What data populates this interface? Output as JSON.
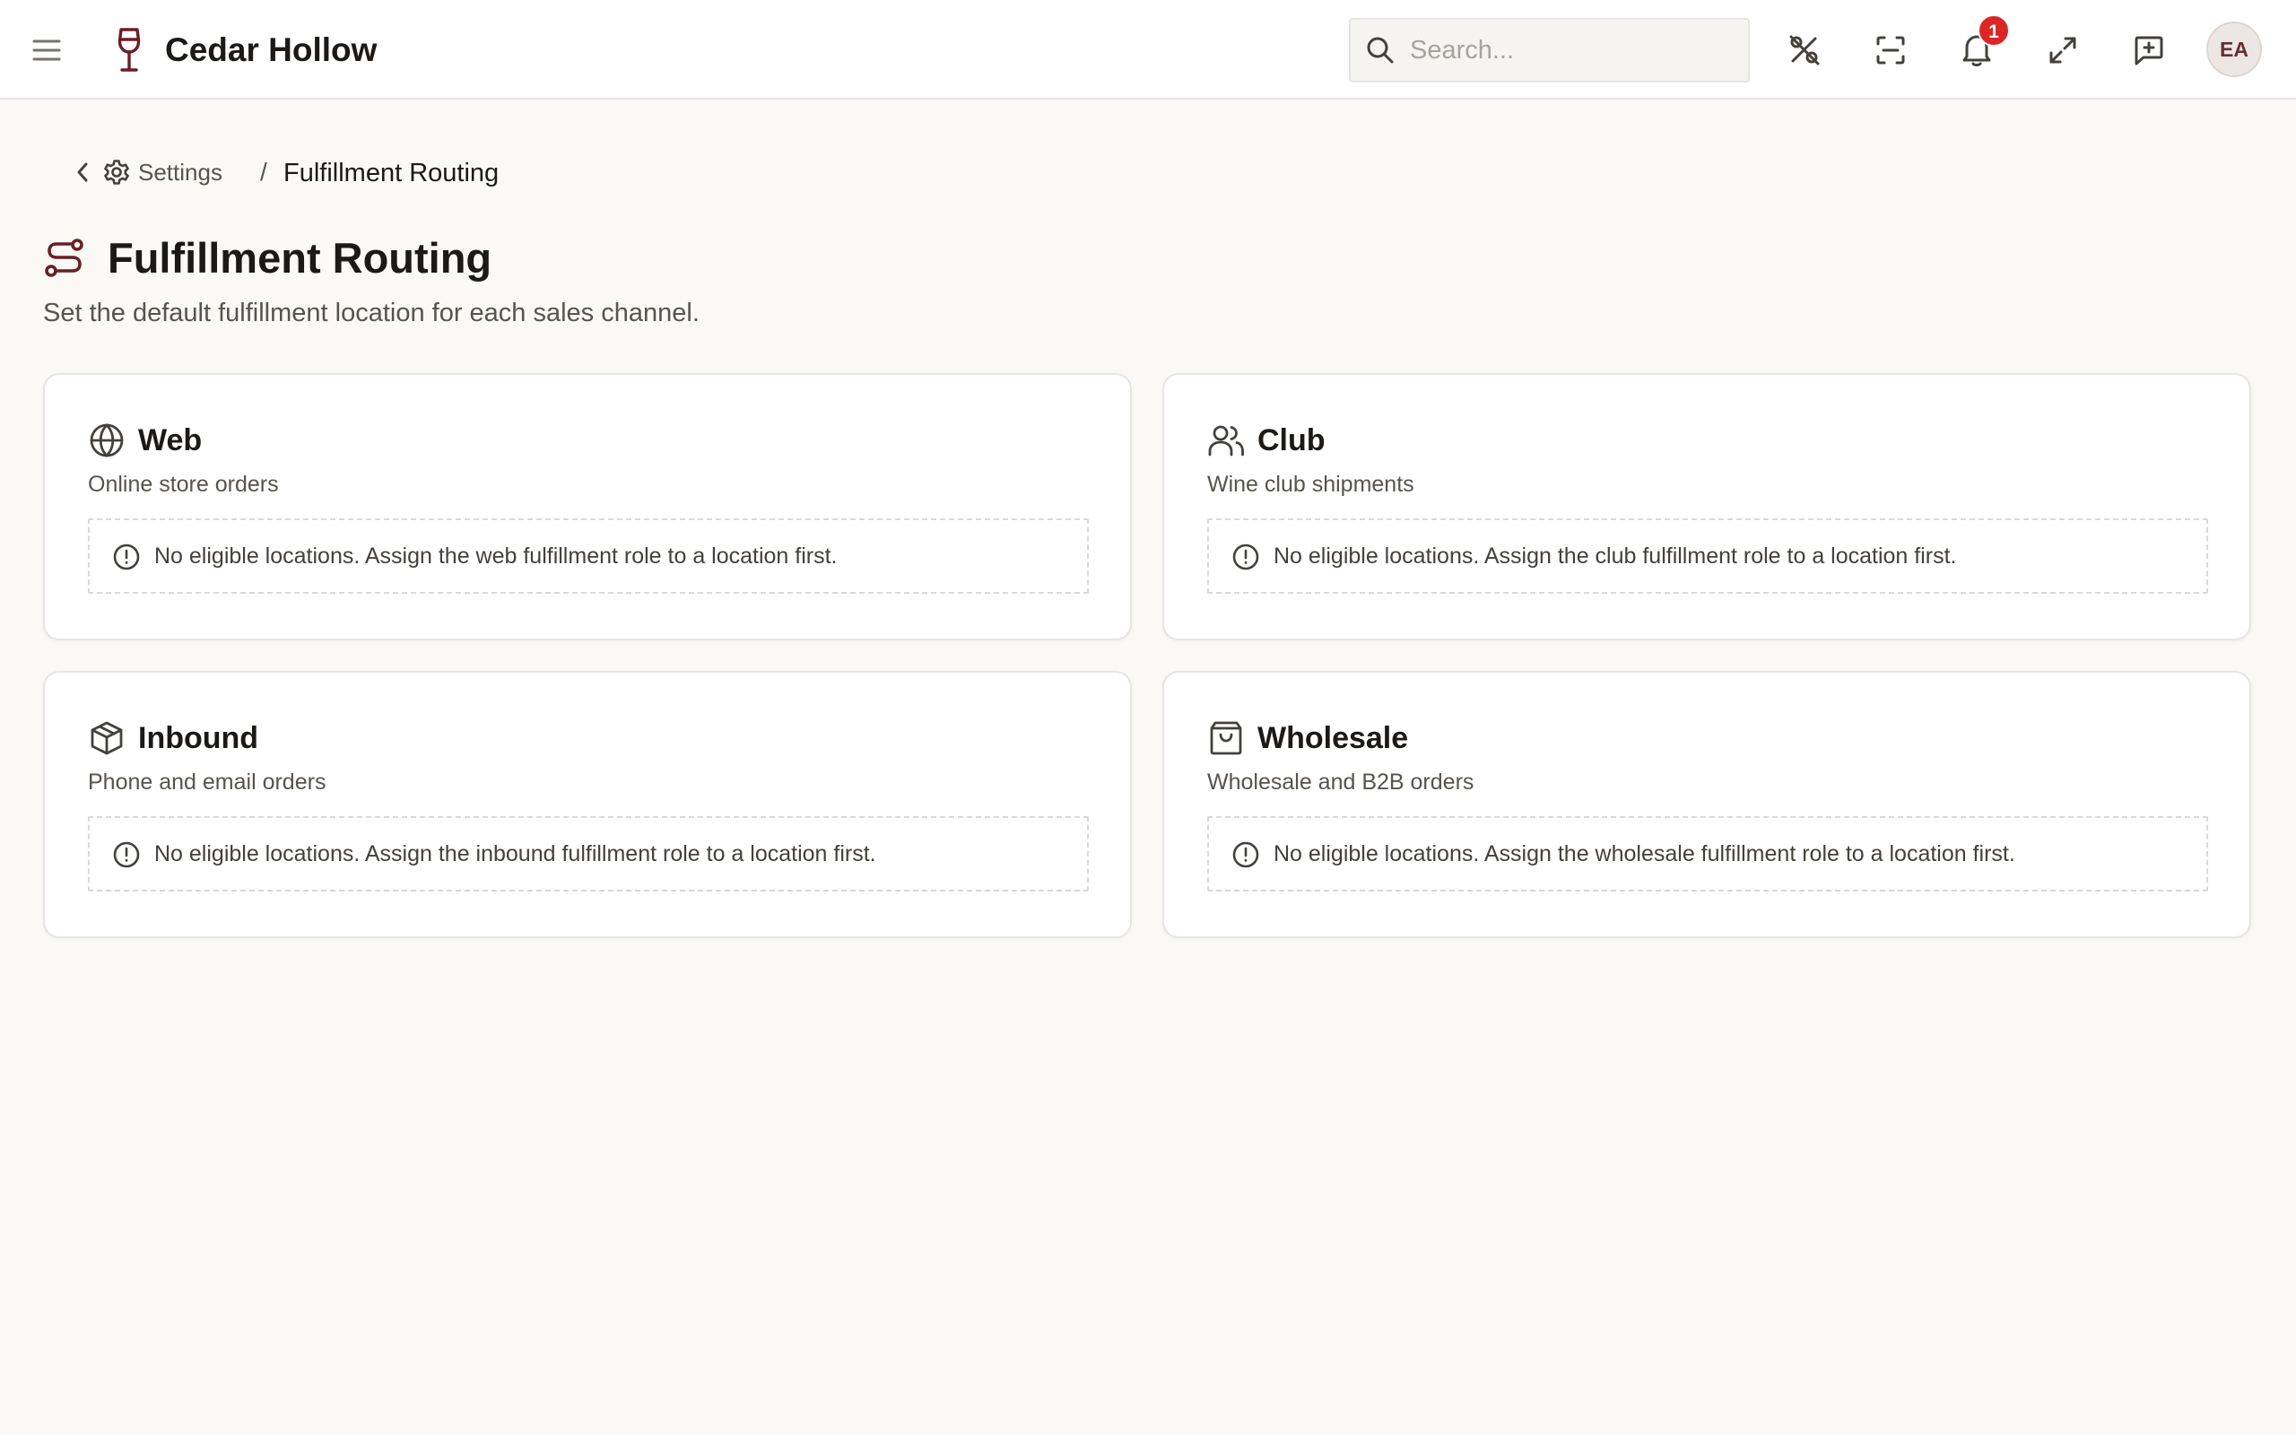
{
  "app": {
    "name": "Cedar Hollow",
    "brand_color": "#6b1e24"
  },
  "header": {
    "search_placeholder": "Search...",
    "notification_count": "1",
    "avatar_initials": "EA",
    "icons": [
      "menu-icon",
      "wine-glass-icon",
      "search-icon",
      "percent-slash-icon",
      "scan-icon",
      "bell-icon",
      "expand-icon",
      "message-plus-icon"
    ]
  },
  "breadcrumb": {
    "parent": "Settings",
    "separator": "/",
    "current": "Fulfillment Routing"
  },
  "page": {
    "title": "Fulfillment Routing",
    "subtitle": "Set the default fulfillment location for each sales channel."
  },
  "channels": [
    {
      "icon": "globe-icon",
      "title": "Web",
      "description": "Online store orders",
      "notice": "No eligible locations. Assign the web fulfillment role to a location first."
    },
    {
      "icon": "users-icon",
      "title": "Club",
      "description": "Wine club shipments",
      "notice": "No eligible locations. Assign the club fulfillment role to a location first."
    },
    {
      "icon": "package-icon",
      "title": "Inbound",
      "description": "Phone and email orders",
      "notice": "No eligible locations. Assign the inbound fulfillment role to a location first."
    },
    {
      "icon": "shopping-bag-icon",
      "title": "Wholesale",
      "description": "Wholesale and B2B orders",
      "notice": "No eligible locations. Assign the wholesale fulfillment role to a location first."
    }
  ]
}
